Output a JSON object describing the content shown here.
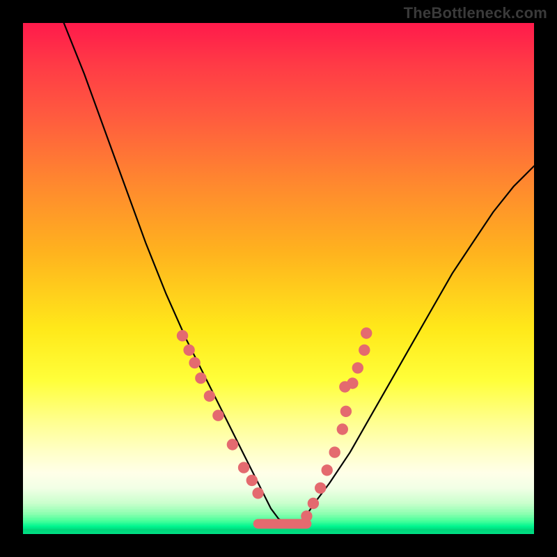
{
  "watermark": "TheBottleneck.com",
  "colors": {
    "dot": "#e46a6f",
    "curve": "#000000",
    "frame": "#000000"
  },
  "chart_data": {
    "type": "line",
    "title": "",
    "xlabel": "",
    "ylabel": "",
    "xlim": [
      0,
      100
    ],
    "ylim": [
      0,
      100
    ],
    "grid": false,
    "legend": false,
    "series": [
      {
        "name": "bottleneck-curve",
        "x": [
          8,
          12,
          16,
          20,
          24,
          28,
          32,
          36,
          40,
          43,
          45,
          47,
          48.5,
          50,
          51.5,
          53,
          55,
          57,
          60,
          64,
          68,
          72,
          76,
          80,
          84,
          88,
          92,
          96,
          100
        ],
        "y": [
          100,
          90,
          79,
          68,
          57,
          47,
          38,
          30,
          22,
          16,
          12,
          8,
          5,
          3,
          2,
          2,
          3,
          6,
          10,
          16,
          23,
          30,
          37,
          44,
          51,
          57,
          63,
          68,
          72
        ]
      }
    ],
    "markers": [
      {
        "name": "left-cluster",
        "x": 31.2,
        "y": 38.8
      },
      {
        "name": "left-cluster",
        "x": 32.5,
        "y": 36.0
      },
      {
        "name": "left-cluster",
        "x": 33.6,
        "y": 33.5
      },
      {
        "name": "left-cluster",
        "x": 34.8,
        "y": 30.5
      },
      {
        "name": "left-cluster",
        "x": 36.5,
        "y": 27.0
      },
      {
        "name": "left-cluster",
        "x": 38.2,
        "y": 23.2
      },
      {
        "name": "left-cluster",
        "x": 41.0,
        "y": 17.5
      },
      {
        "name": "left-cluster",
        "x": 43.2,
        "y": 13.0
      },
      {
        "name": "left-cluster",
        "x": 44.8,
        "y": 10.5
      },
      {
        "name": "left-cluster",
        "x": 46.0,
        "y": 8.0
      },
      {
        "name": "right-cluster",
        "x": 55.5,
        "y": 3.5
      },
      {
        "name": "right-cluster",
        "x": 56.8,
        "y": 6.0
      },
      {
        "name": "right-cluster",
        "x": 58.2,
        "y": 9.0
      },
      {
        "name": "right-cluster",
        "x": 59.5,
        "y": 12.5
      },
      {
        "name": "right-cluster",
        "x": 61.0,
        "y": 16.0
      },
      {
        "name": "right-cluster",
        "x": 62.5,
        "y": 20.5
      },
      {
        "name": "right-cluster",
        "x": 63.2,
        "y": 24.0
      },
      {
        "name": "right-cluster",
        "x": 63.0,
        "y": 28.8
      },
      {
        "name": "right-cluster",
        "x": 64.5,
        "y": 29.5
      },
      {
        "name": "right-cluster",
        "x": 65.5,
        "y": 32.5
      },
      {
        "name": "right-cluster",
        "x": 66.8,
        "y": 36.0
      },
      {
        "name": "right-cluster",
        "x": 67.2,
        "y": 39.3
      }
    ],
    "flat_segment": {
      "x_start": 46.0,
      "x_end": 55.5,
      "y": 2.0
    }
  }
}
